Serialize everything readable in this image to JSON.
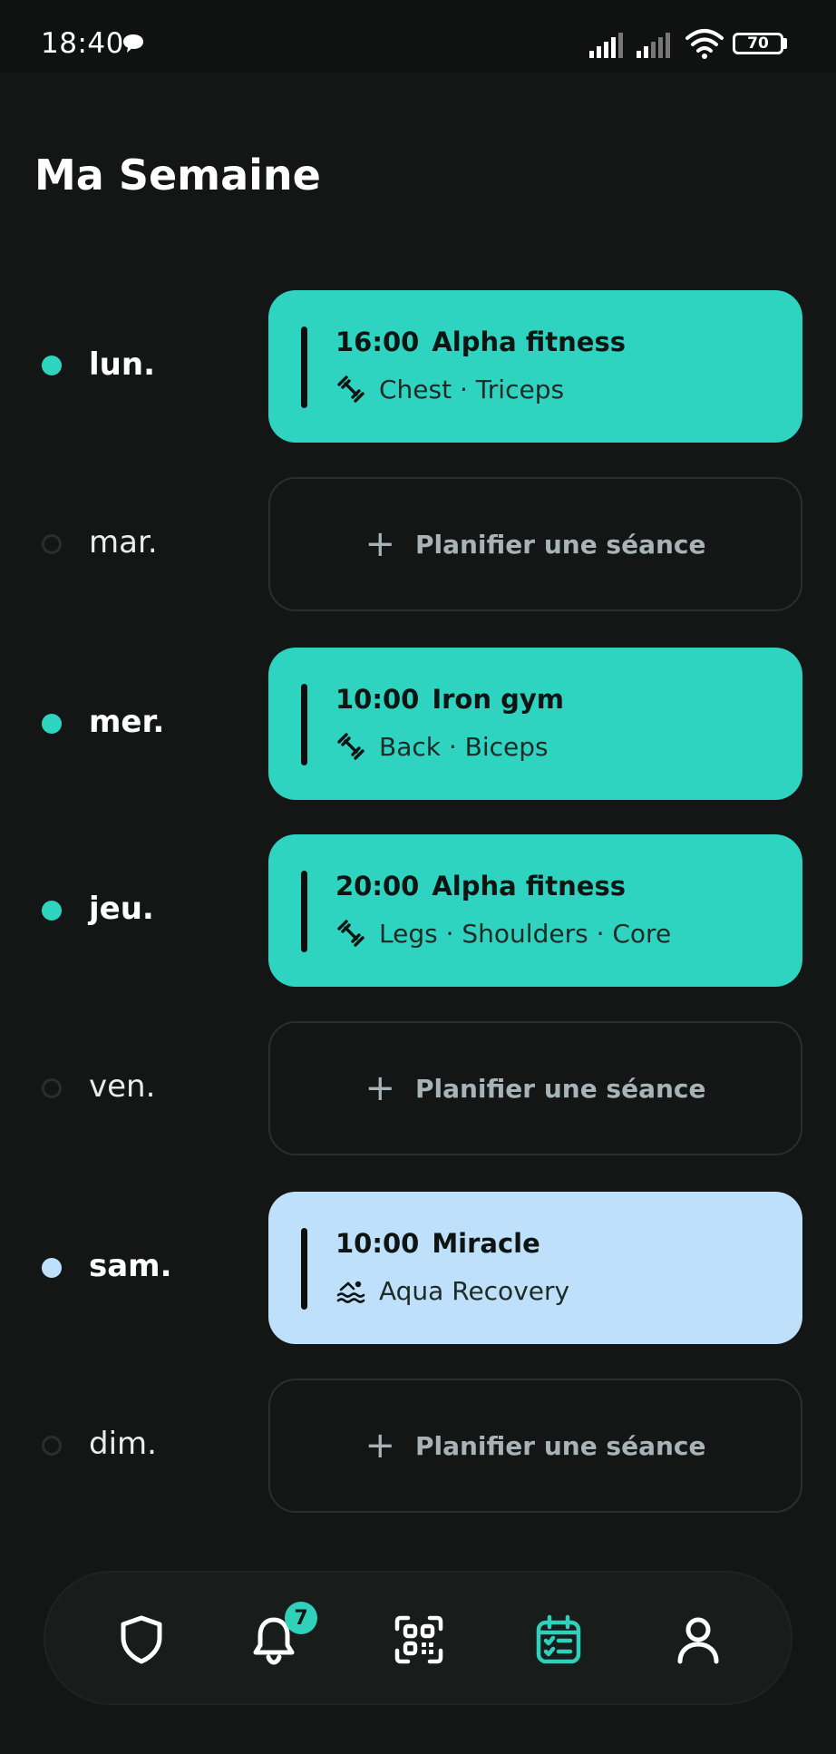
{
  "status_bar": {
    "time": "18:40",
    "battery": "70"
  },
  "page": {
    "title": "Ma Semaine"
  },
  "days": [
    {
      "label": "lun.",
      "session": {
        "time": "16:00",
        "gym": "Alpha fitness",
        "detail": "Chest · Triceps",
        "icon": "dumbbell-icon",
        "color": "#2fd4c0"
      }
    },
    {
      "label": "mar.",
      "plan_label": "Planifier une séance"
    },
    {
      "label": "mer.",
      "session": {
        "time": "10:00",
        "gym": "Iron gym",
        "detail": "Back · Biceps",
        "icon": "dumbbell-icon",
        "color": "#2fd4c0"
      }
    },
    {
      "label": "jeu.",
      "session": {
        "time": "20:00",
        "gym": "Alpha fitness",
        "detail": "Legs · Shoulders · Core",
        "icon": "dumbbell-icon",
        "color": "#2fd4c0"
      }
    },
    {
      "label": "ven.",
      "plan_label": "Planifier une séance"
    },
    {
      "label": "sam.",
      "session": {
        "time": "10:00",
        "gym": "Miracle",
        "detail": "Aqua Recovery",
        "icon": "swimming-icon",
        "color": "#bfe0fb"
      }
    },
    {
      "label": "dim.",
      "plan_label": "Planifier une séance"
    }
  ],
  "nav": {
    "items": [
      "shield-icon",
      "bell-icon",
      "qr-code-icon",
      "calendar-icon",
      "profile-icon"
    ],
    "active": "calendar-icon",
    "notification_count": "7"
  },
  "colors": {
    "accent": "#2fd4c0",
    "recovery": "#bfe0fb",
    "background": "#131614"
  }
}
